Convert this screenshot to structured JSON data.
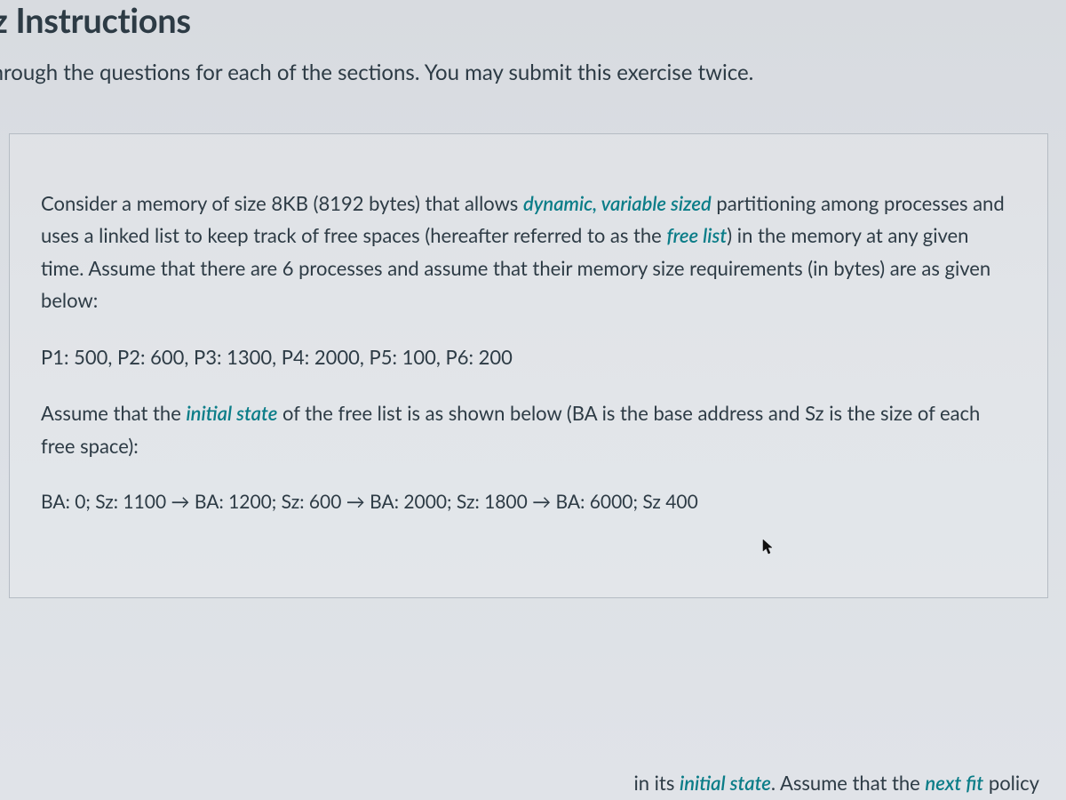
{
  "header": {
    "title": "iz Instructions"
  },
  "instructions": {
    "line": "through the questions for each of the sections. You may submit this exercise twice."
  },
  "question": {
    "para1_pre": "Consider a memory of size 8KB (8192 bytes) that allows ",
    "para1_em1": "dynamic, variable sized",
    "para1_mid": " partitioning among processes and uses a linked list to keep track of free spaces (hereafter referred to as the ",
    "para1_em2": "free list",
    "para1_post": ") in the memory at any given time. Assume that there are 6 processes and assume that their memory size requirements (in bytes) are as given below:",
    "process_line": "P1: 500,  P2: 600,  P3: 1300,  P4: 2000,  P5: 100,  P6: 200",
    "para2_pre": "Assume that the ",
    "para2_em": "initial state",
    "para2_post": " of the free list is as shown below (BA is the base address and Sz is the size of each free space):",
    "free_list_line": "BA: 0; Sz: 1100 → BA: 1200; Sz: 600 → BA: 2000; Sz: 1800 → BA: 6000; Sz 400"
  },
  "bottom_fragment": {
    "pre": "in its ",
    "em1": "initial state",
    "mid": ". Assume that the ",
    "em2": "next fit",
    "post": " policy"
  },
  "cursor_glyph": "➤"
}
